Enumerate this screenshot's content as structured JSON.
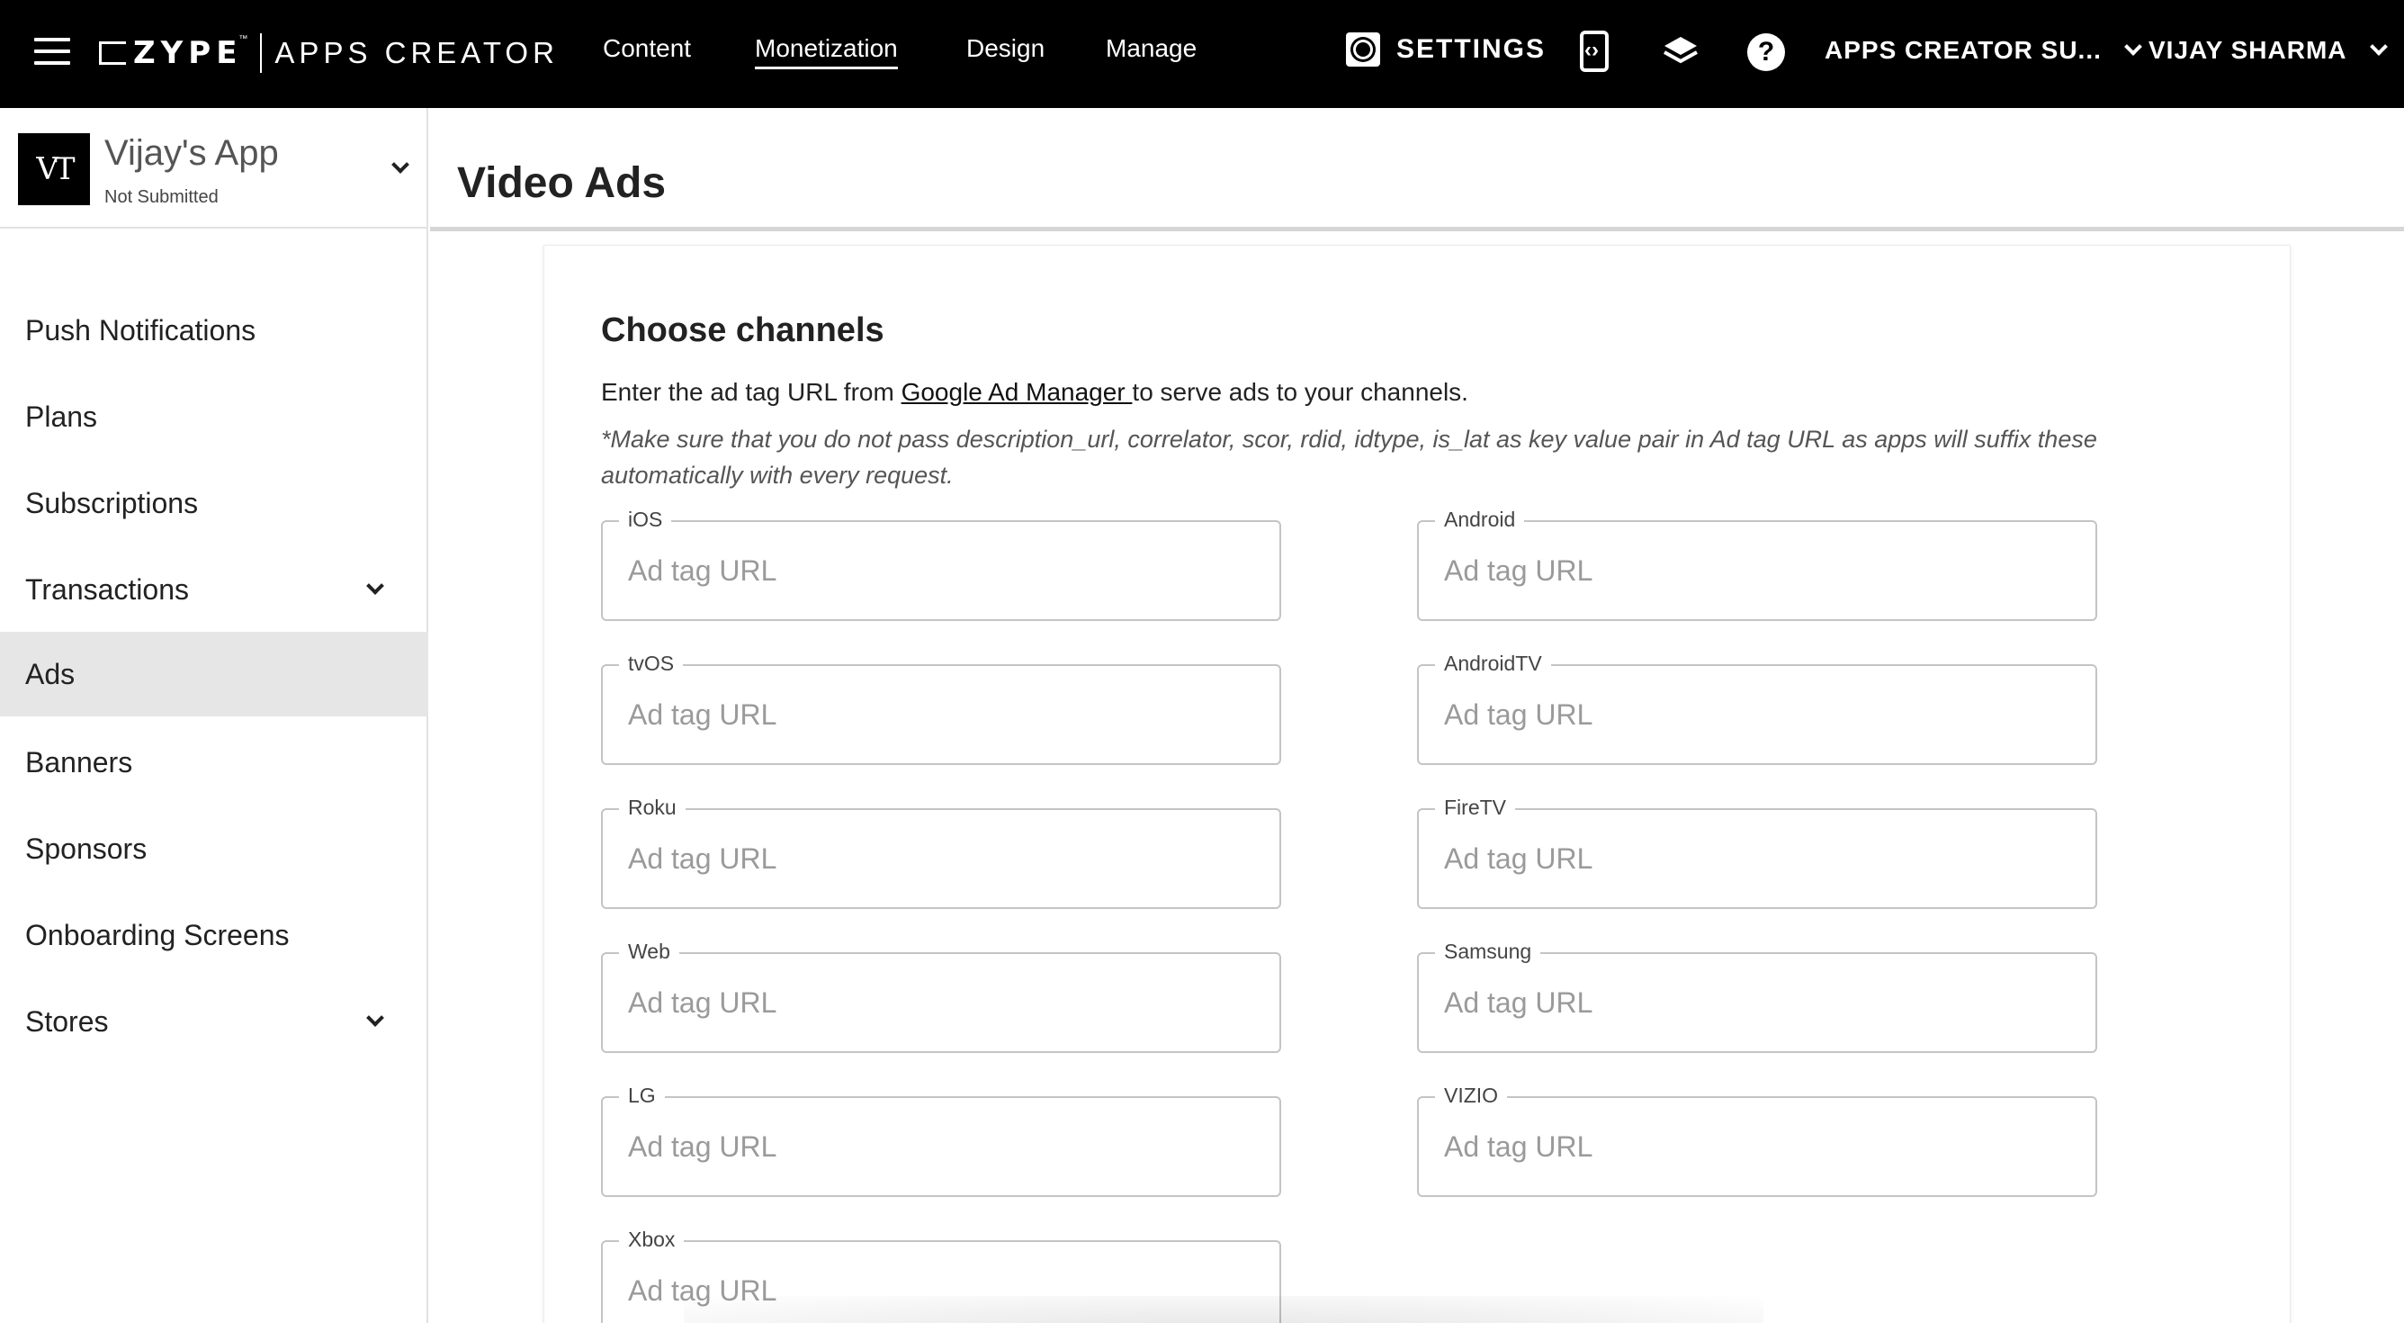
{
  "topbar": {
    "logo": {
      "brand": "ZYPE",
      "tm": "™",
      "product": "APPS CREATOR"
    },
    "nav": [
      {
        "label": "Content"
      },
      {
        "label": "Monetization"
      },
      {
        "label": "Design"
      },
      {
        "label": "Manage"
      }
    ],
    "settings_label": "SETTINGS",
    "account_menu": "APPS CREATOR SU...",
    "user_menu": "VIJAY SHARMA",
    "icons": [
      "menu-icon",
      "gear-icon",
      "code-icon",
      "layers-icon",
      "help-icon",
      "chevron-down-icon"
    ]
  },
  "sidebar": {
    "app": {
      "avatar_text": "VT",
      "name": "Vijay's App",
      "status": "Not Submitted"
    },
    "items": [
      {
        "label": "Push Notifications"
      },
      {
        "label": "Plans"
      },
      {
        "label": "Subscriptions"
      },
      {
        "label": "Transactions"
      },
      {
        "label": "Ads"
      },
      {
        "label": "Banners"
      },
      {
        "label": "Sponsors"
      },
      {
        "label": "Onboarding Screens"
      },
      {
        "label": "Stores"
      }
    ]
  },
  "main": {
    "title": "Video Ads",
    "section_title": "Choose channels",
    "intro_before": "Enter the ad tag URL from ",
    "intro_link": "Google Ad Manager ",
    "intro_after": "to serve ads to your channels.",
    "note": "*Make sure that you do not pass description_url, correlator, scor, rdid, idtype, is_lat as key value pair in Ad tag URL as apps will suffix these automatically with every request.",
    "placeholder": "Ad tag URL",
    "channels": [
      {
        "label": "iOS"
      },
      {
        "label": "Android"
      },
      {
        "label": "tvOS"
      },
      {
        "label": "AndroidTV"
      },
      {
        "label": "Roku"
      },
      {
        "label": "FireTV"
      },
      {
        "label": "Web"
      },
      {
        "label": "Samsung"
      },
      {
        "label": "LG"
      },
      {
        "label": "VIZIO"
      },
      {
        "label": "Xbox"
      }
    ]
  }
}
